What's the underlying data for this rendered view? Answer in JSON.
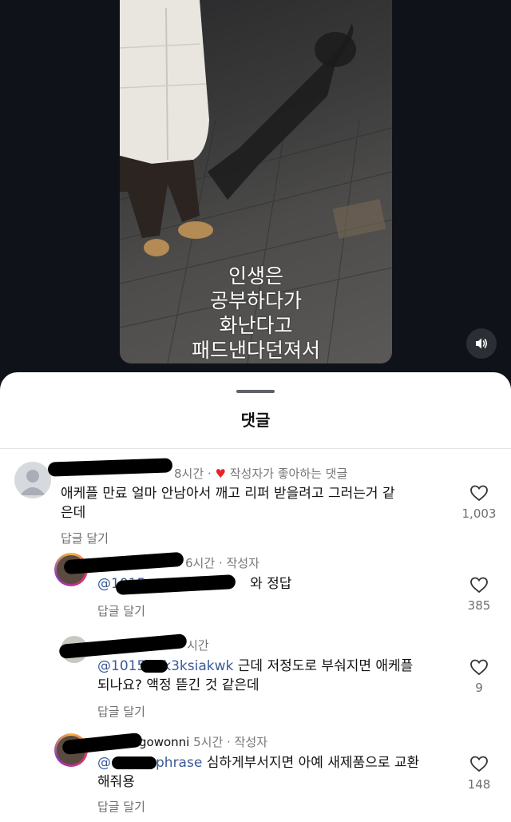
{
  "video": {
    "caption_lines": [
      "인생은",
      "공부하다가",
      "화난다고",
      "패드낸다던져서"
    ]
  },
  "sheet": {
    "title": "댓글"
  },
  "comments": [
    {
      "time": "8시간",
      "separator": "·",
      "badge": "작성자가 좋아하는 댓글",
      "text_line1": "애케플 만료 얼마 안남아서 깨고 리퍼 받을려고 그러는거 같",
      "text_line2": "은데",
      "reply_label": "답글 달기",
      "likes": "1,003"
    },
    {
      "time": "6시간",
      "separator": "·",
      "badge": "작성자",
      "mention": "@1015",
      "text": "와 정답",
      "reply_label": "답글 달기",
      "likes": "385"
    },
    {
      "time": "시간",
      "mention": "@1015",
      "mention_tail": "k3ksiakwk",
      "text_line1": "근데 저정도로 부숴지면 애케플",
      "text_line2": "되나요? 액정 뜯긴 것 같은데",
      "reply_label": "답글 달기",
      "likes": "9"
    },
    {
      "username_fragment": "gowonni",
      "time": "5시간",
      "separator": "·",
      "badge": "작성자",
      "mention": "@",
      "mention_tail": "phrase",
      "text_line1": "심하게부서지면 아예 새제품으로 교환",
      "text_line2": "해줘용",
      "reply_label": "답글 달기",
      "likes": "148"
    }
  ],
  "colors": {
    "background_dark": "#0f1319",
    "sheet": "#ffffff",
    "heart": "#e5242a",
    "mention": "#3a5a98",
    "muted": "#777777"
  },
  "icons": {
    "sound": "speaker-icon",
    "like": "heart-outline-icon",
    "badge": "heart-filled-icon",
    "avatar_default": "person-silhouette-icon"
  }
}
